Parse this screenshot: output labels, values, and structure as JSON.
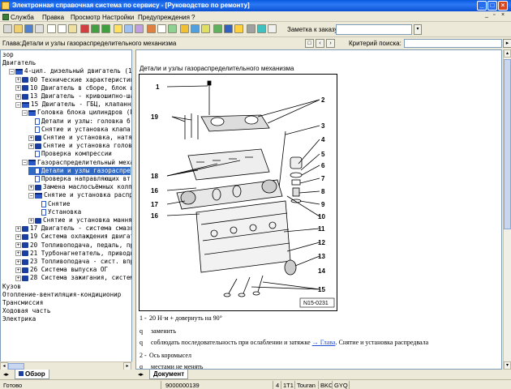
{
  "window": {
    "title": "Электронная справочная система по сервису - [Руководство по ремонту]"
  },
  "menu": [
    "Служба",
    "Правка",
    "Просмотр",
    "Настройки",
    "Предупреждения",
    "?"
  ],
  "toolbar": {
    "order_note_label": "Заметка к заказу:",
    "order_note_value": ""
  },
  "chapterbar": {
    "chapter": "Глава:Детали и узлы газораспределительного механизма",
    "search_label": "Критерий  поиска:",
    "search_value": ""
  },
  "tree": [
    {
      "text": "зор",
      "indent": 0,
      "icon": "none",
      "exp": ""
    },
    {
      "text": "Двигатель",
      "indent": 0,
      "icon": "none",
      "exp": ""
    },
    {
      "text": "4-цил. дизельный двигатель (1,",
      "indent": 1,
      "icon": "bookopen",
      "exp": "-"
    },
    {
      "text": "00 Технические характеристик",
      "indent": 2,
      "icon": "book",
      "exp": "+"
    },
    {
      "text": "10 Двигатель в сборе, блок ц",
      "indent": 2,
      "icon": "book",
      "exp": "+"
    },
    {
      "text": "13 Двигатель - кривошипно-ша",
      "indent": 2,
      "icon": "book",
      "exp": "+"
    },
    {
      "text": "15 Двигатель - ГБЦ, клапанны",
      "indent": 2,
      "icon": "bookopen",
      "exp": "-"
    },
    {
      "text": "Головка блока цилиндров (Г",
      "indent": 3,
      "icon": "bookopen",
      "exp": "-"
    },
    {
      "text": "Детали и узлы: головка б",
      "indent": 4,
      "icon": "doc",
      "exp": ""
    },
    {
      "text": "Снятие и установка клапа",
      "indent": 4,
      "icon": "doc",
      "exp": ""
    },
    {
      "text": "Снятие и установка, натя",
      "indent": 4,
      "icon": "book",
      "exp": "+"
    },
    {
      "text": "Снятие и установка голов",
      "indent": 4,
      "icon": "book",
      "exp": "+"
    },
    {
      "text": "Проверка компрессии",
      "indent": 4,
      "icon": "doc",
      "exp": ""
    },
    {
      "text": "Газораспределительный меха",
      "indent": 3,
      "icon": "bookopen",
      "exp": "-"
    },
    {
      "text": "Детали и узлы газораспре",
      "indent": 4,
      "icon": "doc",
      "exp": "",
      "selected": true
    },
    {
      "text": "Проверка направляющих вт",
      "indent": 4,
      "icon": "doc",
      "exp": ""
    },
    {
      "text": "Замена маслосъёмных колп",
      "indent": 4,
      "icon": "book",
      "exp": "+"
    },
    {
      "text": "Снятие и установка распр",
      "indent": 4,
      "icon": "bookopen",
      "exp": "-"
    },
    {
      "text": "Снятие",
      "indent": 5,
      "icon": "doc",
      "exp": ""
    },
    {
      "text": "Установка",
      "indent": 5,
      "icon": "doc",
      "exp": ""
    },
    {
      "text": "Снятие и установка мання",
      "indent": 4,
      "icon": "book",
      "exp": "+"
    },
    {
      "text": "17 Двигатель - система смазк",
      "indent": 2,
      "icon": "book",
      "exp": "+"
    },
    {
      "text": "19 Система охлаждения двигат",
      "indent": 2,
      "icon": "book",
      "exp": "+"
    },
    {
      "text": "20 Топливоподача, педаль, пр",
      "indent": 2,
      "icon": "book",
      "exp": "+"
    },
    {
      "text": "21 Турбонагнетатель, приводн",
      "indent": 2,
      "icon": "book",
      "exp": "+"
    },
    {
      "text": "23 Топливоподача - сист. впр",
      "indent": 2,
      "icon": "book",
      "exp": "+"
    },
    {
      "text": "26 Система выпуска ОГ",
      "indent": 2,
      "icon": "book",
      "exp": "+"
    },
    {
      "text": "28 Система зажигания, систем",
      "indent": 2,
      "icon": "book",
      "exp": "+"
    },
    {
      "text": "Кузов",
      "indent": 0,
      "icon": "none",
      "exp": ""
    },
    {
      "text": "Отопление-вентиляция-кондиционир",
      "indent": 0,
      "icon": "none",
      "exp": ""
    },
    {
      "text": "Трансмиссия",
      "indent": 0,
      "icon": "none",
      "exp": ""
    },
    {
      "text": "Ходовая часть",
      "indent": 0,
      "icon": "none",
      "exp": ""
    },
    {
      "text": "Электрика",
      "indent": 0,
      "icon": "none",
      "exp": ""
    }
  ],
  "document": {
    "title": "Детали и узлы газораспределительного механизма",
    "figure_code": "N15-0231",
    "callouts": [
      "1",
      "2",
      "3",
      "4",
      "5",
      "6",
      "7",
      "8",
      "9",
      "10",
      "11",
      "12",
      "13",
      "14",
      "15",
      "16",
      "16",
      "17",
      "18",
      "19"
    ],
    "legend": [
      {
        "prefix": "1 -",
        "text": "20 Н·м + довернуть на 90°"
      },
      {
        "prefix": "q",
        "text": "заменить"
      },
      {
        "prefix": "q",
        "text": "соблюдать последовательность при ослаблении и затяжке ",
        "link": "→ Глава",
        "after": ". Снятие и установка распредвала"
      },
      {
        "prefix": "2 -",
        "text": "Ось коромысел"
      },
      {
        "prefix": "q",
        "text": "местами не менять"
      }
    ]
  },
  "tabs": {
    "left": "Обзор",
    "right": "Документ"
  },
  "status": {
    "state": "Готово",
    "code": "9000000139",
    "f1": "4",
    "f2": "1T1",
    "f3": "Touran",
    "f4": "BKC",
    "f5": "GYQ"
  },
  "colors": {
    "selection": "#316ac5",
    "link": "#1f4fd8",
    "titlebar": "#0a5ae0"
  }
}
